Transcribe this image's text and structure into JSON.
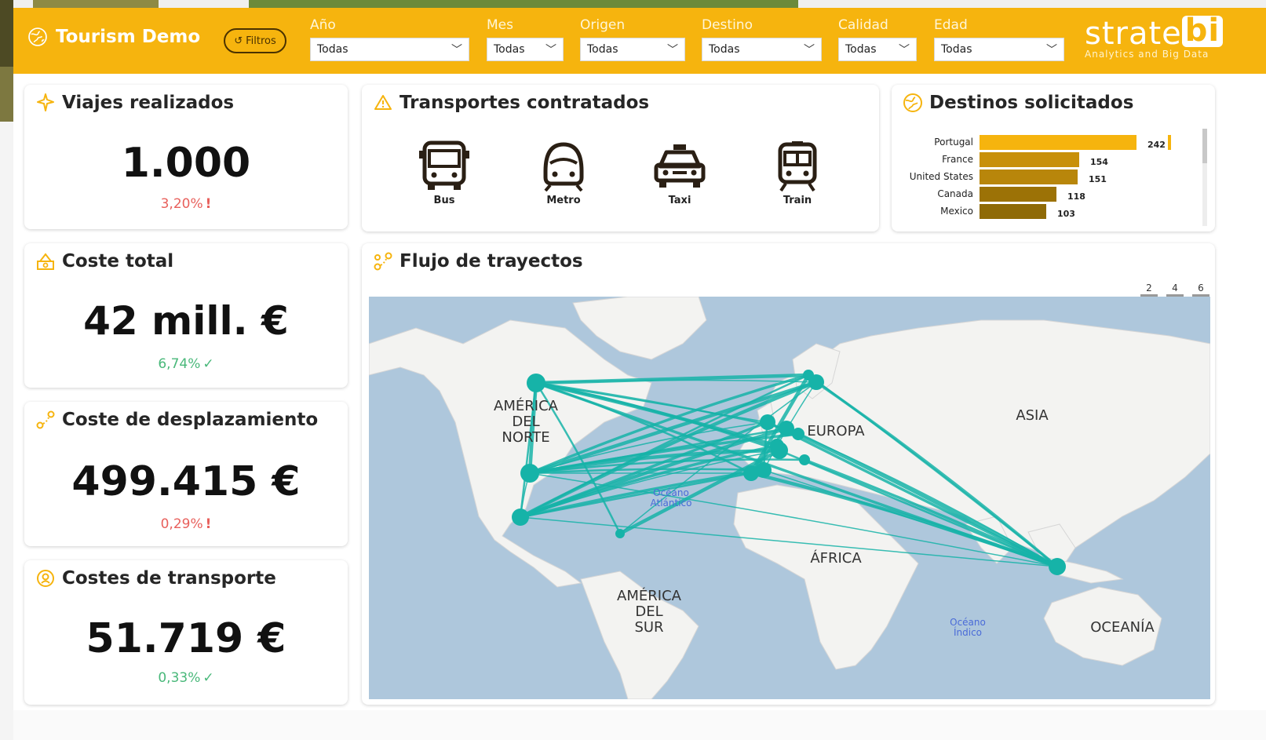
{
  "header": {
    "title": "Tourism Demo",
    "filters_button": "Filtros",
    "filters": [
      {
        "label": "Año",
        "value": "Todas"
      },
      {
        "label": "Mes",
        "value": "Todas"
      },
      {
        "label": "Origen",
        "value": "Todas"
      },
      {
        "label": "Destino",
        "value": "Todas"
      },
      {
        "label": "Calidad",
        "value": "Todas"
      },
      {
        "label": "Edad",
        "value": "Todas"
      }
    ],
    "logo": {
      "main": "strate",
      "bi": "bi",
      "sub": "Analytics and Big Data"
    },
    "accent_color": "#f6b40e"
  },
  "kpis": {
    "viajes": {
      "title": "Viajes realizados",
      "value": "1.000",
      "delta": "3,20%",
      "status": "bad"
    },
    "coste_total": {
      "title": "Coste total",
      "value": "42 mill. €",
      "delta": "6,74%",
      "status": "good"
    },
    "coste_desplazamiento": {
      "title": "Coste de desplazamiento",
      "value": "499.415 €",
      "delta": "0,29%",
      "status": "bad"
    },
    "costes_transporte": {
      "title": "Costes de transporte",
      "value": "51.719 €",
      "delta": "0,33%",
      "status": "good"
    }
  },
  "transportes": {
    "title": "Transportes contratados",
    "items": [
      {
        "label": "Bus",
        "icon": "bus-icon"
      },
      {
        "label": "Metro",
        "icon": "metro-icon"
      },
      {
        "label": "Taxi",
        "icon": "taxi-icon"
      },
      {
        "label": "Train",
        "icon": "train-icon"
      }
    ]
  },
  "destinos": {
    "title": "Destinos solicitados",
    "chart_data": {
      "type": "bar",
      "orientation": "horizontal",
      "categories": [
        "Portugal",
        "France",
        "United States",
        "Canada",
        "Mexico"
      ],
      "values": [
        242,
        154,
        151,
        118,
        103
      ],
      "colors": [
        "#f6b40e",
        "#c8900a",
        "#b8860b",
        "#9c7206",
        "#8f6a06"
      ]
    }
  },
  "flujo": {
    "title": "Flujo de trayectos",
    "legend_sizes": [
      "2",
      "4",
      "6"
    ],
    "continents": [
      {
        "name": "AMÉRICA DEL NORTE",
        "lines": [
          "AMÉRICA",
          "DEL",
          "NORTE"
        ]
      },
      {
        "name": "EUROPA",
        "lines": [
          "EUROPA"
        ]
      },
      {
        "name": "ASIA",
        "lines": [
          "ASIA"
        ]
      },
      {
        "name": "ÁFRICA",
        "lines": [
          "ÁFRICA"
        ]
      },
      {
        "name": "AMÉRICA DEL SUR",
        "lines": [
          "AMÉRICA",
          "DEL",
          "SUR"
        ]
      },
      {
        "name": "OCEANÍA",
        "lines": [
          "OCEANÍA"
        ]
      }
    ],
    "oceans": [
      {
        "name": "Océano Atlántico",
        "lines": [
          "Océano",
          "Atlántico"
        ]
      },
      {
        "name": "Océano Índico",
        "lines": [
          "Océano",
          "Índico"
        ]
      }
    ],
    "flow_color": "#16b3a8"
  }
}
